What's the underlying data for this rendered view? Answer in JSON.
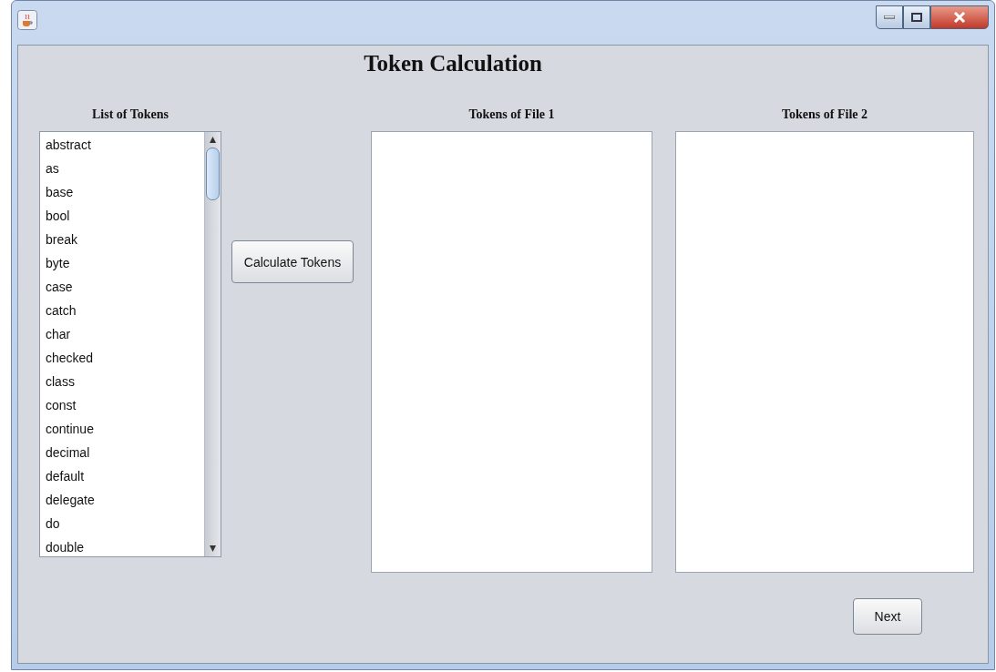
{
  "window": {
    "title": "Token Calculation"
  },
  "tokens_list": {
    "label": "List of Tokens",
    "items": [
      "abstract",
      "as",
      "base",
      "bool",
      "break",
      "byte",
      "case",
      "catch",
      "char",
      "checked",
      "class",
      "const",
      "continue",
      "decimal",
      "default",
      "delegate",
      "do",
      "double"
    ]
  },
  "calculate_button": "Calculate Tokens",
  "file1_panel": {
    "label": "Tokens of File 1"
  },
  "file2_panel": {
    "label": "Tokens of File 2"
  },
  "next_button": "Next"
}
